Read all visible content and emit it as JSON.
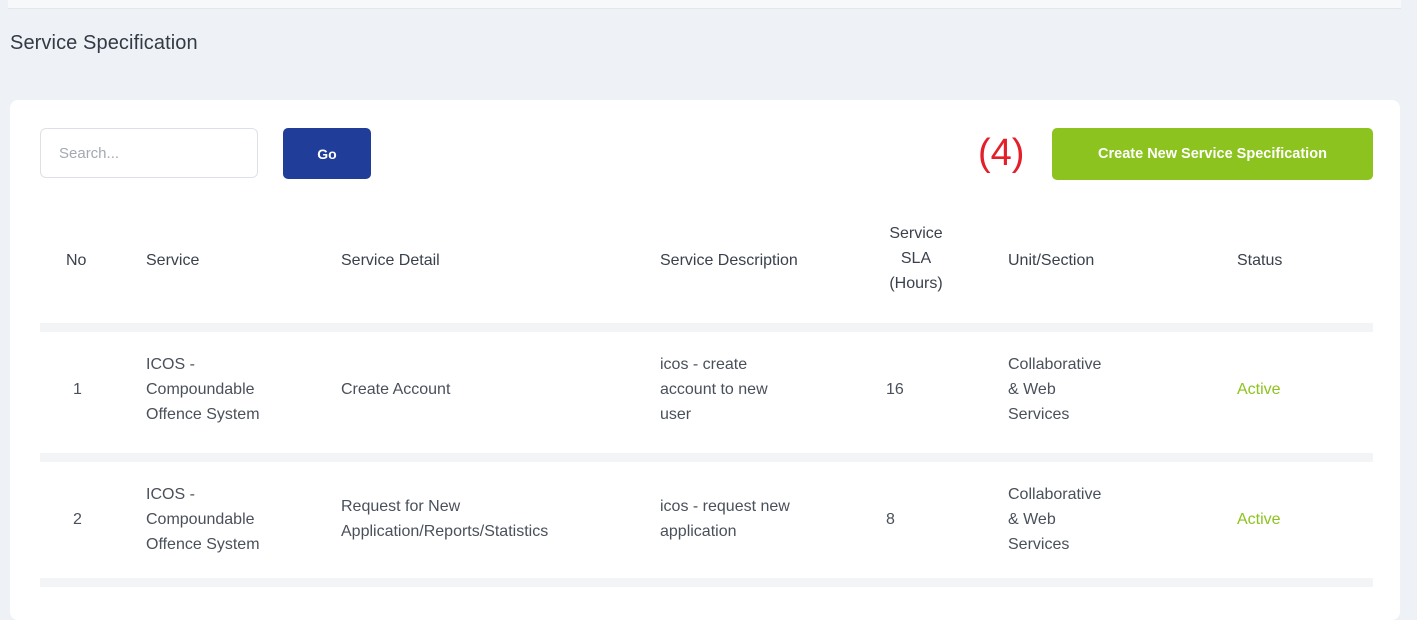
{
  "page": {
    "title": "Service Specification"
  },
  "toolbar": {
    "search_placeholder": "Search...",
    "go_label": "Go",
    "annotation": "(4)",
    "create_label": "Create New Service Specification"
  },
  "table": {
    "headers": {
      "no": "No",
      "service": "Service",
      "detail": "Service Detail",
      "description": "Service Description",
      "sla_line1": "Service",
      "sla_line2": "SLA",
      "sla_line3": "(Hours)",
      "unit": "Unit/Section",
      "status": "Status"
    },
    "rows": [
      {
        "no": "1",
        "service_l1": "ICOS -",
        "service_l2": "Compoundable",
        "service_l3": "Offence System",
        "detail_l1": "Create Account",
        "description_l1": "icos - create",
        "description_l2": "account to new",
        "description_l3": "user",
        "sla": "16",
        "unit_l1": "Collaborative",
        "unit_l2": "& Web",
        "unit_l3": "Services",
        "status": "Active"
      },
      {
        "no": "2",
        "service_l1": "ICOS -",
        "service_l2": "Compoundable",
        "service_l3": "Offence System",
        "detail_l1": "Request for New",
        "detail_l2": "Application/Reports/Statistics",
        "description_l1": "icos - request new",
        "description_l2": "application",
        "sla": "8",
        "unit_l1": "Collaborative",
        "unit_l2": "& Web",
        "unit_l3": "Services",
        "status": "Active"
      }
    ]
  },
  "colors": {
    "go_button": "#1f3d99",
    "create_button": "#8cc31e",
    "status_active": "#8cc31e",
    "annotation": "#e3202a"
  }
}
